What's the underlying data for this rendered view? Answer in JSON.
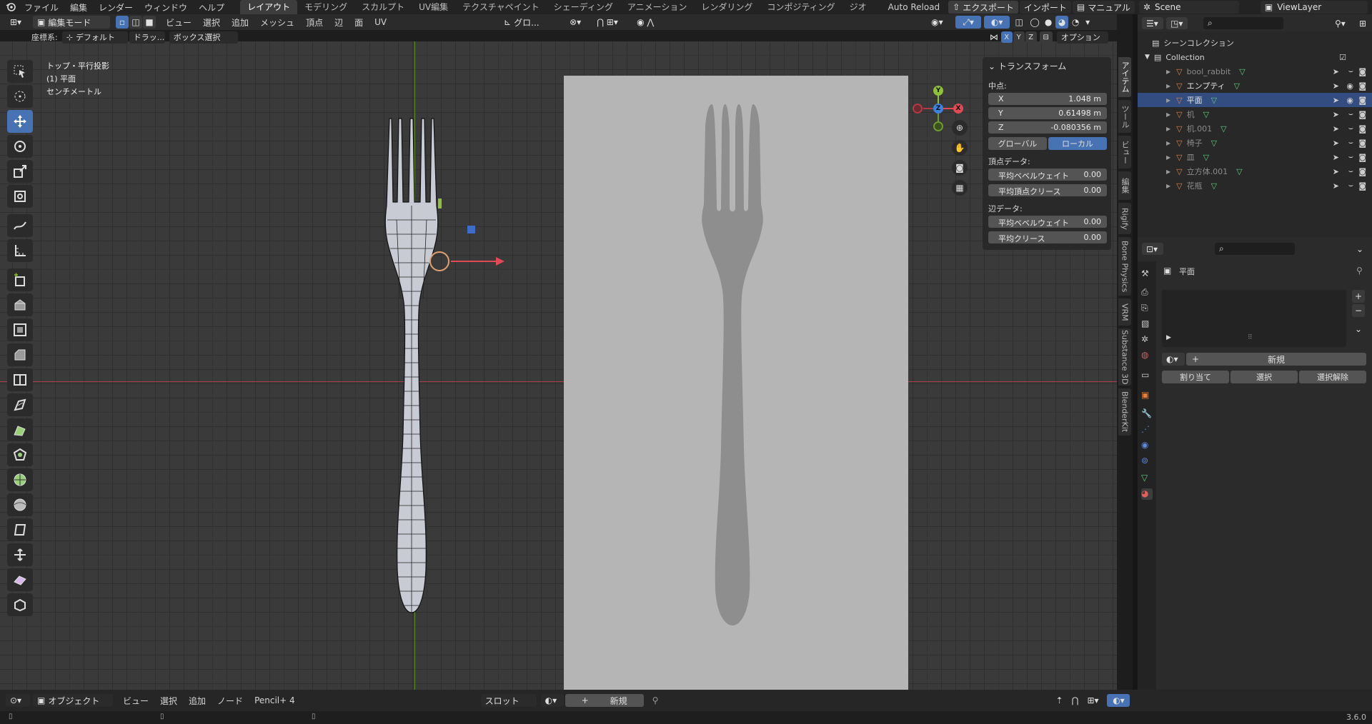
{
  "topbar": {
    "menus": [
      "ファイル",
      "編集",
      "レンダー",
      "ウィンドウ",
      "ヘルプ"
    ],
    "workspaces": [
      "レイアウト",
      "モデリング",
      "スカルプト",
      "UV編集",
      "テクスチャペイント",
      "シェーディング",
      "アニメーション",
      "レンダリング",
      "コンポジティング",
      "ジオ"
    ],
    "active_workspace": "レイアウト",
    "auto_reload": "Auto Reload",
    "export": "エクスポート",
    "import": "インポート",
    "manual": "マニュアル",
    "scene": "Scene",
    "view_layer": "ViewLayer"
  },
  "viewport_header": {
    "mode": "編集モード",
    "menus": [
      "ビュー",
      "選択",
      "追加",
      "メッシュ",
      "頂点",
      "辺",
      "面",
      "UV"
    ],
    "pivot": "グロ...",
    "coord_label": "座標系:",
    "coord_value": "デフォルト",
    "drag_label": "ドラッ...",
    "box_select": "ボックス選択",
    "axes": [
      "X",
      "Y",
      "Z"
    ],
    "options": "オプション"
  },
  "viewport_info": {
    "view_name": "トップ・平行投影",
    "object": "(1) 平面",
    "units": "センチメートル"
  },
  "npanel": {
    "section": "トランスフォーム",
    "median_label": "中点:",
    "x_label": "X",
    "x_value": "1.048 m",
    "y_label": "Y",
    "y_value": "0.61498 m",
    "z_label": "Z",
    "z_value": "-0.080356 m",
    "global": "グローバル",
    "local": "ローカル",
    "vertex_data": "頂点データ:",
    "vertex_bevel": "平均ベベルウェイト",
    "vertex_bevel_val": "0.00",
    "vertex_crease": "平均頂点クリース",
    "vertex_crease_val": "0.00",
    "edge_data": "辺データ:",
    "edge_bevel": "平均ベベルウェイト",
    "edge_bevel_val": "0.00",
    "edge_crease": "平均クリース",
    "edge_crease_val": "0.00"
  },
  "side_tabs": [
    "アイテム",
    "ツール",
    "ビュー",
    "編集",
    "Rigify",
    "Bone Physics",
    "VRM",
    "Substance 3D",
    "BlenderKit"
  ],
  "outliner": {
    "scene_collection": "シーンコレクション",
    "collection": "Collection",
    "items": [
      {
        "name": "bool_rabbit",
        "dim": true
      },
      {
        "name": "エンプティ",
        "dim": false
      },
      {
        "name": "平面",
        "dim": false,
        "selected": true
      },
      {
        "name": "机",
        "dim": true
      },
      {
        "name": "机.001",
        "dim": true
      },
      {
        "name": "椅子",
        "dim": true
      },
      {
        "name": "皿",
        "dim": true
      },
      {
        "name": "立方体.001",
        "dim": true
      },
      {
        "name": "花瓶",
        "dim": true
      }
    ]
  },
  "properties": {
    "object_name": "平面",
    "new_button": "新規",
    "assign": "割り当て",
    "select": "選択",
    "deselect": "選択解除"
  },
  "bottombar": {
    "editor": "オブジェクト",
    "menus": [
      "ビュー",
      "選択",
      "追加",
      "ノード"
    ],
    "pencil": "Pencil+ 4",
    "slot": "スロット",
    "new": "新規"
  },
  "status": {
    "version": "3.6.0"
  },
  "colors": {
    "accent": "#4772b3",
    "selected_row": "#334d80",
    "x_axis": "#e04a55",
    "y_axis": "#8ec03c",
    "z_axis": "#3e82e0"
  }
}
